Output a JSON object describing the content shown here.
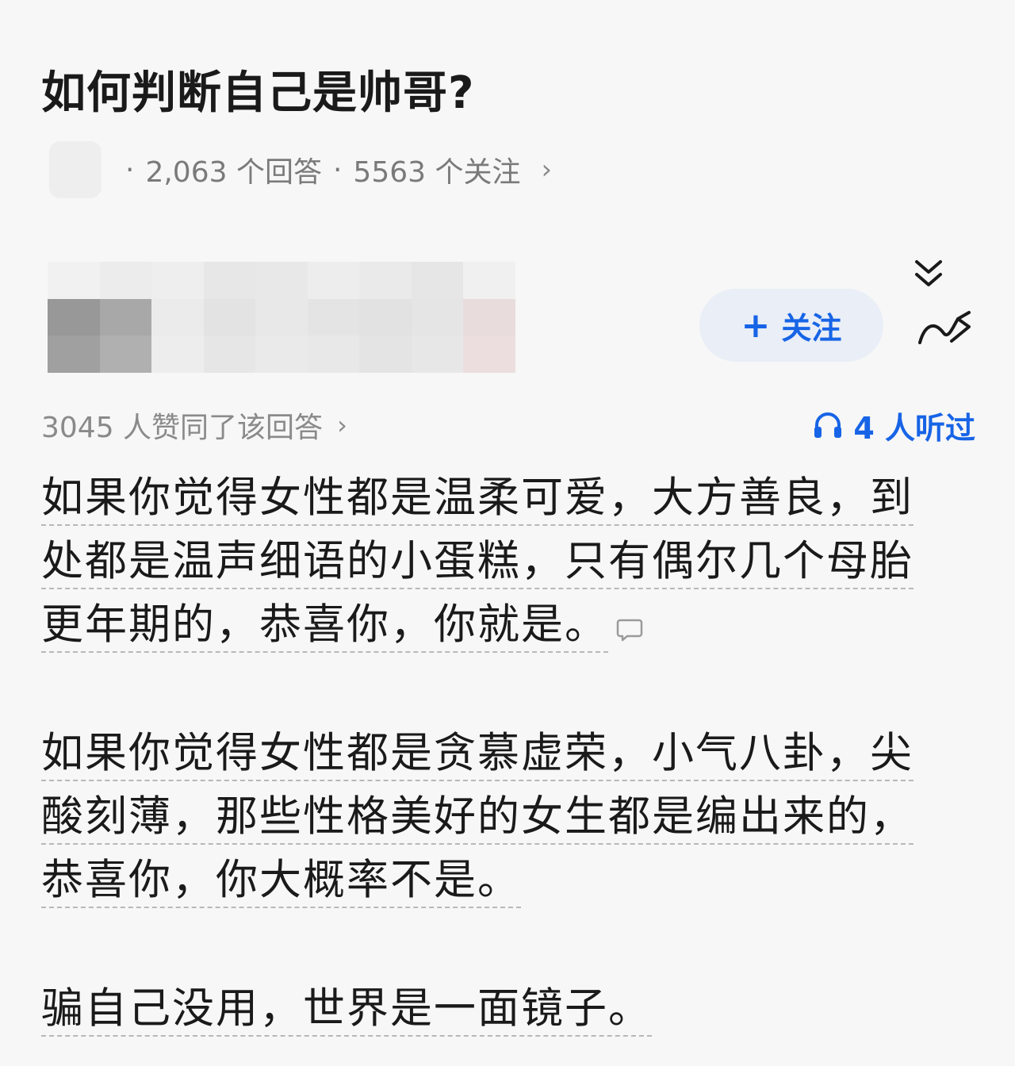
{
  "question": {
    "title": "如何判断自己是帅哥?",
    "answer_count": "2,063 个回答",
    "follow_count": "5563 个关注",
    "separator": "·"
  },
  "author": {
    "follow_label": "关注",
    "follow_plus": "+"
  },
  "stats": {
    "votes": "3045 人赞同了该回答",
    "listeners": "4 人听过"
  },
  "answer": {
    "paragraphs": [
      "如果你觉得女性都是温柔可爱，大方善良，到处都是温声细语的小蛋糕，只有偶尔几个母胎更年期的，恭喜你，你就是。",
      "如果你觉得女性都是贪慕虚荣，小气八卦，尖酸刻薄，那些性格美好的女生都是编出来的，恭喜你，你大概率不是。",
      "骗自己没用，世界是一面镜子。"
    ]
  },
  "colors": {
    "accent": "#1764e6",
    "follow_bg": "#e9eef7",
    "text": "#1a1a1a",
    "secondary": "#7a7a7a",
    "background": "#f7f7f7"
  },
  "icons": [
    "chevron-right-icon",
    "collapse-icon",
    "share-icon",
    "headphone-icon",
    "comment-icon"
  ]
}
